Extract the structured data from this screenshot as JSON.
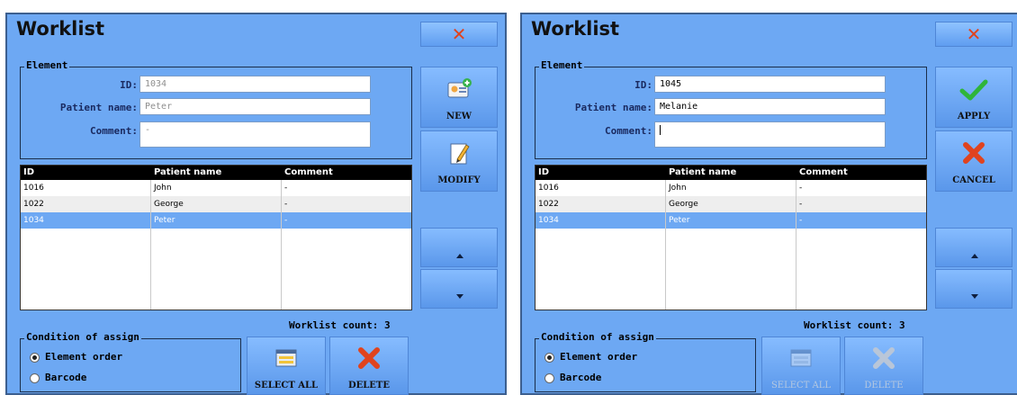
{
  "colors": {
    "panel_bg": "#6da8f3",
    "button_bg": "#6ea8f6",
    "selected_row": "#6da8f3",
    "close_x": "#e0431e",
    "apply_check": "#2fb53a"
  },
  "left": {
    "title": "Worklist",
    "element_legend": "Element",
    "id_label": "ID:",
    "id_value": "1034",
    "patient_label": "Patient name:",
    "patient_value": "Peter",
    "comment_label": "Comment:",
    "comment_value": "-",
    "buttons": {
      "top": "NEW",
      "second": "MODIFY",
      "select_all": "SELECT ALL",
      "delete": "DELETE"
    },
    "icons": {
      "close": "close-icon",
      "top": "new-icon",
      "second": "edit-icon",
      "up": "arrow-up-icon",
      "down": "arrow-down-icon",
      "select_all": "select-all-icon",
      "delete": "delete-icon"
    },
    "table": {
      "columns": [
        "ID",
        "Patient name",
        "Comment"
      ],
      "rows": [
        [
          "1016",
          "John",
          "-"
        ],
        [
          "1022",
          "George",
          "-"
        ],
        [
          "1034",
          "Peter",
          "-"
        ]
      ],
      "selected_row": 2
    },
    "worklist_count": "Worklist count: 3",
    "condition_legend": "Condition of assign",
    "radio_element_order": "Element order",
    "radio_barcode": "Barcode",
    "selected_radio": "Element order"
  },
  "right": {
    "title": "Worklist",
    "element_legend": "Element",
    "id_label": "ID:",
    "id_value": "1045",
    "patient_label": "Patient name:",
    "patient_value": "Melanie",
    "comment_label": "Comment:",
    "comment_value": "",
    "buttons": {
      "top": "APPLY",
      "second": "CANCEL",
      "select_all": "SELECT ALL",
      "delete": "DELETE"
    },
    "icons": {
      "close": "close-icon",
      "top": "checkmark-icon",
      "second": "cancel-icon",
      "up": "arrow-up-icon",
      "down": "arrow-down-icon",
      "select_all": "select-all-icon",
      "delete": "delete-icon"
    },
    "table": {
      "columns": [
        "ID",
        "Patient name",
        "Comment"
      ],
      "rows": [
        [
          "1016",
          "John",
          "-"
        ],
        [
          "1022",
          "George",
          "-"
        ],
        [
          "1034",
          "Peter",
          "-"
        ]
      ],
      "selected_row": 2
    },
    "worklist_count": "Worklist count: 3",
    "condition_legend": "Condition of assign",
    "radio_element_order": "Element order",
    "radio_barcode": "Barcode",
    "selected_radio": "Element order",
    "select_all_disabled": true,
    "delete_disabled": true
  }
}
